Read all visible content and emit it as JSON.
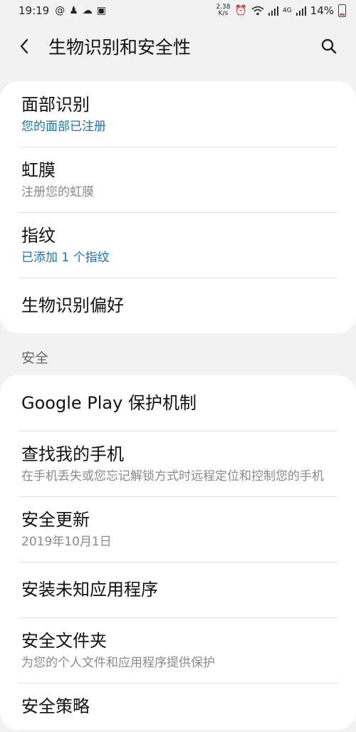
{
  "status_bar": {
    "time": "19:19",
    "net_speed_top": "2.38",
    "net_speed_bottom": "K/s",
    "signal_label": "4G",
    "battery": "14%"
  },
  "header": {
    "title": "生物识别和安全性"
  },
  "biometrics": {
    "items": [
      {
        "title": "面部识别",
        "subtitle": "您的面部已注册"
      },
      {
        "title": "虹膜",
        "subtitle": "注册您的虹膜"
      },
      {
        "title": "指纹",
        "subtitle": "已添加 1 个指纹"
      },
      {
        "title": "生物识别偏好"
      }
    ]
  },
  "security": {
    "section_label": "安全",
    "items": [
      {
        "title": "Google Play 保护机制"
      },
      {
        "title": "查找我的手机",
        "subtitle": "在手机丢失或您忘记解锁方式时远程定位和控制您的手机"
      },
      {
        "title": "安全更新",
        "subtitle": "2019年10月1日"
      },
      {
        "title": "安装未知应用程序"
      },
      {
        "title": "安全文件夹",
        "subtitle": "为您的个人文件和应用程序提供保护"
      },
      {
        "title": "安全策略"
      }
    ]
  },
  "colors": {
    "accent": "#1a73b6",
    "background": "#f2f2f2",
    "card": "#ffffff"
  }
}
